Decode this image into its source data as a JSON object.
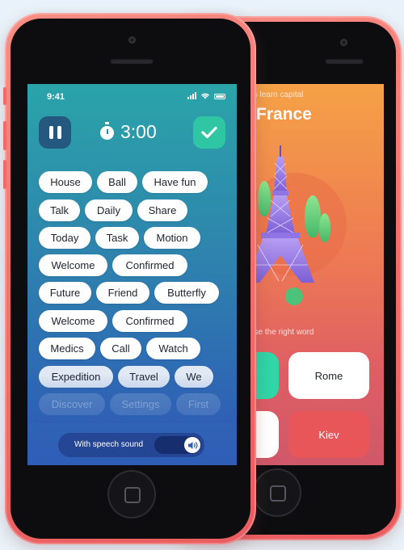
{
  "front": {
    "status": {
      "time": "9:41"
    },
    "timer": {
      "value": "3:00"
    },
    "words": [
      {
        "text": "House",
        "state": "normal"
      },
      {
        "text": "Ball",
        "state": "normal"
      },
      {
        "text": "Have fun",
        "state": "normal"
      },
      {
        "text": "Talk",
        "state": "normal"
      },
      {
        "text": "Daily",
        "state": "normal"
      },
      {
        "text": "Share",
        "state": "normal"
      },
      {
        "text": "Today",
        "state": "normal"
      },
      {
        "text": "Task",
        "state": "normal"
      },
      {
        "text": "Motion",
        "state": "normal"
      },
      {
        "text": "Welcome",
        "state": "normal"
      },
      {
        "text": "Confirmed",
        "state": "normal"
      },
      {
        "text": "Future",
        "state": "normal"
      },
      {
        "text": "Friend",
        "state": "normal"
      },
      {
        "text": "Butterfly",
        "state": "normal"
      },
      {
        "text": "Welcome",
        "state": "normal"
      },
      {
        "text": "Confirmed",
        "state": "normal"
      },
      {
        "text": "Medics",
        "state": "normal"
      },
      {
        "text": "Call",
        "state": "normal"
      },
      {
        "text": "Watch",
        "state": "normal"
      },
      {
        "text": "Expedition",
        "state": "half"
      },
      {
        "text": "Travel",
        "state": "half"
      },
      {
        "text": "We",
        "state": "half"
      },
      {
        "text": "Discover",
        "state": "dim"
      },
      {
        "text": "Settings",
        "state": "dim"
      },
      {
        "text": "First",
        "state": "dim"
      }
    ],
    "speech": {
      "label": "With speech sound",
      "enabled": true
    }
  },
  "back": {
    "subtitle": "t's learn capital",
    "title": "France",
    "question": "ose the right word",
    "answers": [
      {
        "label": "",
        "color": "#2fd6a7"
      },
      {
        "label": "Rome",
        "color": "#ffffff"
      },
      {
        "label": "",
        "color": "#ffffff"
      },
      {
        "label": "Kiev",
        "color": "#e9565a"
      }
    ]
  },
  "colors": {
    "phone_shell": "#f26d6a",
    "accent_green": "#2fc7a3",
    "pause_button": "#24587e"
  },
  "icons": [
    "pause-icon",
    "stopwatch-icon",
    "check-icon",
    "speaker-icon",
    "wifi-icon",
    "signal-icon",
    "battery-icon",
    "eiffel-tower-illustration"
  ]
}
